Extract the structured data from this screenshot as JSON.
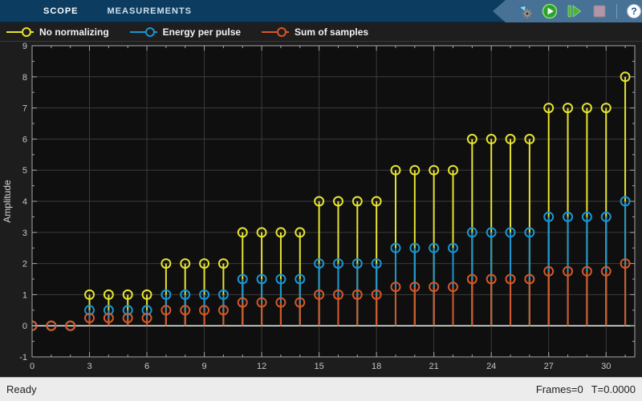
{
  "tab_bar": {
    "tabs": [
      {
        "label": "SCOPE",
        "active": true
      },
      {
        "label": "MEASUREMENTS",
        "active": false
      }
    ]
  },
  "toolbar": {
    "icons": [
      "settings-icon",
      "run-icon",
      "step-forward-icon",
      "stop-icon",
      "help-icon"
    ],
    "help_glyph": "?"
  },
  "legend": {
    "items": [
      {
        "label": "No normalizing"
      },
      {
        "label": "Energy per pulse"
      },
      {
        "label": "Sum of samples"
      }
    ]
  },
  "status_bar": {
    "left": "Ready",
    "frames": "Frames=0",
    "time": "T=0.0000"
  },
  "chart_data": {
    "type": "stem",
    "title": "",
    "xlabel": "",
    "ylabel": "Amplitude",
    "xlim": [
      0,
      31.5
    ],
    "ylim": [
      -1,
      9
    ],
    "xticks": [
      0,
      3,
      6,
      9,
      12,
      15,
      18,
      21,
      24,
      27,
      30
    ],
    "yticks": [
      -1,
      0,
      1,
      2,
      3,
      4,
      5,
      6,
      7,
      8,
      9
    ],
    "grid": true,
    "legend_position": "top-left",
    "baseline": 0,
    "x": [
      0,
      1,
      2,
      3,
      4,
      5,
      6,
      7,
      8,
      9,
      10,
      11,
      12,
      13,
      14,
      15,
      16,
      17,
      18,
      19,
      20,
      21,
      22,
      23,
      24,
      25,
      26,
      27,
      28,
      29,
      30,
      31
    ],
    "series": [
      {
        "name": "No normalizing",
        "color": "#e6e330",
        "values": [
          0,
          0,
          0,
          1,
          1,
          1,
          1,
          2,
          2,
          2,
          2,
          3,
          3,
          3,
          3,
          4,
          4,
          4,
          4,
          5,
          5,
          5,
          5,
          6,
          6,
          6,
          6,
          7,
          7,
          7,
          7,
          8
        ]
      },
      {
        "name": "Energy per pulse",
        "color": "#1b95d2",
        "values": [
          0,
          0,
          0,
          0.5,
          0.5,
          0.5,
          0.5,
          1,
          1,
          1,
          1,
          1.5,
          1.5,
          1.5,
          1.5,
          2,
          2,
          2,
          2,
          2.5,
          2.5,
          2.5,
          2.5,
          3,
          3,
          3,
          3,
          3.5,
          3.5,
          3.5,
          3.5,
          4
        ]
      },
      {
        "name": "Sum of samples",
        "color": "#d4582a",
        "values": [
          0,
          0,
          0,
          0.25,
          0.25,
          0.25,
          0.25,
          0.5,
          0.5,
          0.5,
          0.5,
          0.75,
          0.75,
          0.75,
          0.75,
          1,
          1,
          1,
          1,
          1.25,
          1.25,
          1.25,
          1.25,
          1.5,
          1.5,
          1.5,
          1.5,
          1.75,
          1.75,
          1.75,
          1.75,
          2
        ]
      }
    ],
    "colors": {
      "figure_bg": "#1d1d1d",
      "axes_bg": "#0f0f0f",
      "grid": "#3c3c3c",
      "axis": "#a6a6a6",
      "tick_label": "#c4c4c4",
      "baseline": "#f2f2f2"
    }
  }
}
